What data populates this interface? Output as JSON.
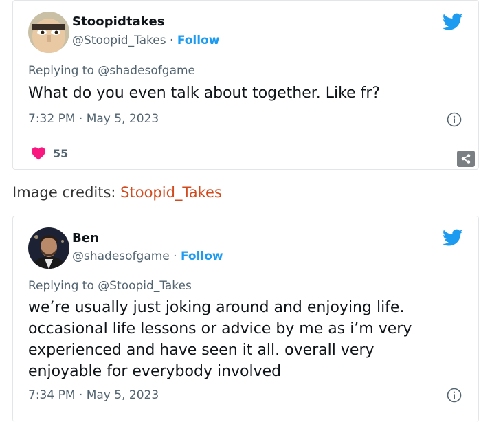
{
  "tweets": [
    {
      "display_name": "Stoopidtakes",
      "handle": "@Stoopid_Takes",
      "separator": " · ",
      "follow_label": "Follow",
      "replying_prefix": "Replying to ",
      "replying_to": "@shadesofgame",
      "text": "What do you even talk about together. Like fr?",
      "timestamp": "7:32 PM · May 5, 2023",
      "likes": "55",
      "avatar_icon": "avatar-cartoon-face",
      "colors": {
        "heart": "#f91880",
        "link": "#1d9bf0"
      }
    },
    {
      "display_name": "Ben",
      "handle": "@shadesofgame",
      "separator": " · ",
      "follow_label": "Follow",
      "replying_prefix": "Replying to ",
      "replying_to": "@Stoopid_Takes",
      "text": "we’re usually just joking around and enjoying life.\noccasional life lessons or advice by me as i’m very\nexperienced and have seen it all. overall very\nenjoyable for everybody involved",
      "timestamp": "7:34 PM · May 5, 2023",
      "avatar_icon": "avatar-photo-man"
    }
  ],
  "credits": {
    "label": "Image credits: ",
    "source": "Stoopid_Takes",
    "color": "#d14b1f"
  }
}
